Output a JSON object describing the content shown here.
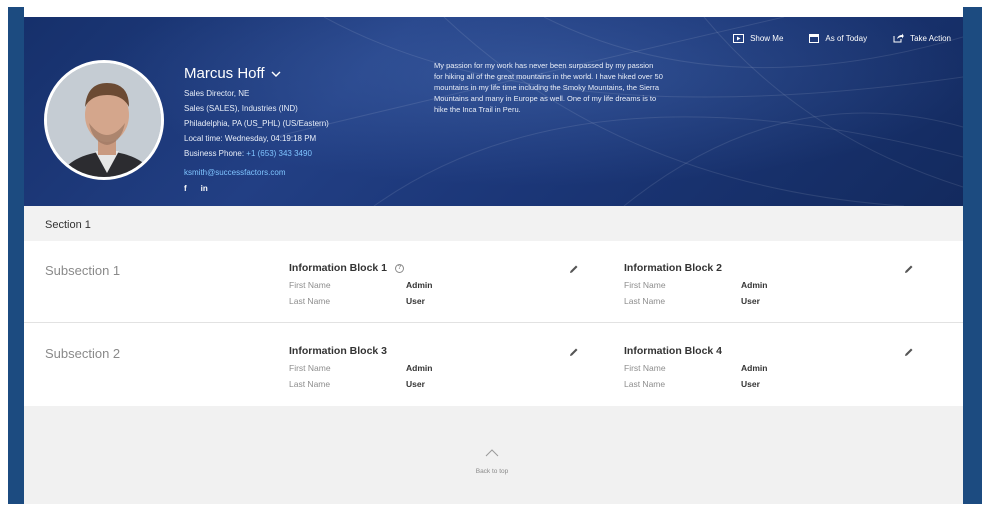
{
  "actions": [
    {
      "label": "Show Me",
      "icon": "show-me-icon"
    },
    {
      "label": "As of Today",
      "icon": "calendar-icon"
    },
    {
      "label": "Take Action",
      "icon": "take-action-icon"
    }
  ],
  "profile": {
    "name": "Marcus Hoff",
    "title": "Sales Director, NE",
    "department": "Sales (SALES), Industries (IND)",
    "location": "Philadelphia, PA (US_PHL) (US/Eastern)",
    "local_time": "Local time: Wednesday, 04:19:18 PM",
    "phone_label": "Business Phone:",
    "phone": "+1 (653) 343 3490",
    "email": "ksmith@successfactors.com",
    "social": [
      "f",
      "in"
    ]
  },
  "bio": "My passion for my work has never been surpassed by my passion for hiking all of the great mountains in the world. I have hiked over 50 mountains in my life time including the Smoky Mountains, the Sierra Mountains and many in Europe as well. One of my life dreams is to hike the Inca Trail in Peru.",
  "section": {
    "title": "Section 1"
  },
  "subsections": [
    {
      "title": "Subsection 1",
      "blocks": [
        {
          "title": "Information Block 1",
          "has_help": true,
          "fields": [
            {
              "label": "First Name",
              "value": "Admin"
            },
            {
              "label": "Last Name",
              "value": "User"
            }
          ]
        },
        {
          "title": "Information Block 2",
          "has_help": false,
          "fields": [
            {
              "label": "First Name",
              "value": "Admin"
            },
            {
              "label": "Last Name",
              "value": "User"
            }
          ]
        }
      ]
    },
    {
      "title": "Subsection 2",
      "blocks": [
        {
          "title": "Information Block 3",
          "has_help": false,
          "fields": [
            {
              "label": "First Name",
              "value": "Admin"
            },
            {
              "label": "Last Name",
              "value": "User"
            }
          ]
        },
        {
          "title": "Information Block 4",
          "has_help": false,
          "fields": [
            {
              "label": "First Name",
              "value": "Admin"
            },
            {
              "label": "Last Name",
              "value": "User"
            }
          ]
        }
      ]
    }
  ],
  "back_to_top": "Back to top",
  "colors": {
    "header_blue": "#1c3a7a",
    "frame_blue": "#1c4b80",
    "link_blue": "#7fc4ff"
  }
}
